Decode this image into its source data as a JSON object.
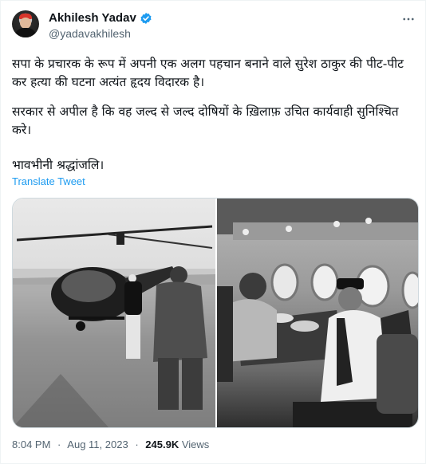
{
  "author": {
    "display_name": "Akhilesh Yadav",
    "handle": "@yadavakhilesh",
    "verified_icon": "verified-badge-icon",
    "accent_color": "#1d9bf0"
  },
  "more_icon": "more-options-icon",
  "tweet": {
    "paragraph_1": "सपा के प्रचारक के रूप में अपनी एक अलग पहचान बनाने वाले सुरेश ठाकुर की पीट-पीट कर हत्या की घटना अत्यंत हृदय विदारक है।",
    "paragraph_2": "सरकार से अपील है कि वह जल्द से जल्द दोषियों के ख़िलाफ़ उचित कार्यवाही सुनिश्चित करे।",
    "paragraph_3": "भावभीनी श्रद्धांजलि।"
  },
  "translate_label": "Translate Tweet",
  "meta": {
    "time": "8:04 PM",
    "separator": "·",
    "date": "Aug 11, 2023",
    "views_count": "245.9K",
    "views_label": "Views"
  }
}
